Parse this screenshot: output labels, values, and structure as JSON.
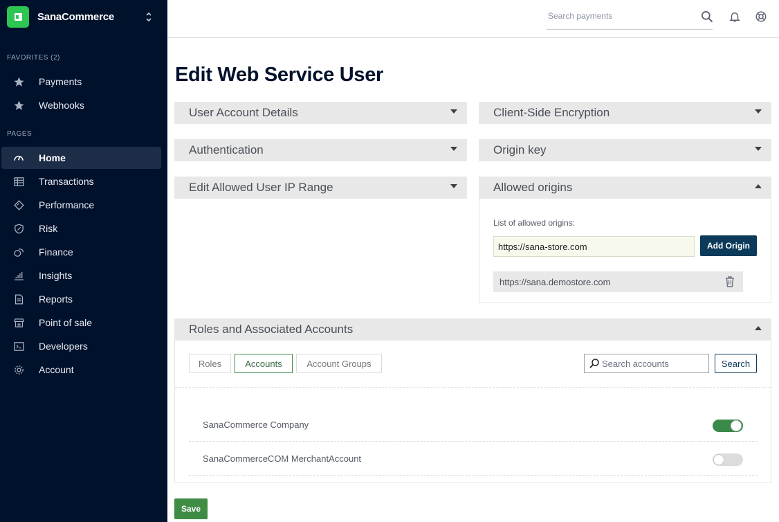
{
  "app": {
    "name": "SanaCommerce"
  },
  "sidebar": {
    "favorites_label": "FAVORITES (2)",
    "favorites": [
      {
        "label": "Payments",
        "icon": "star-icon"
      },
      {
        "label": "Webhooks",
        "icon": "star-icon"
      }
    ],
    "pages_label": "PAGES",
    "pages": [
      {
        "label": "Home",
        "icon": "gauge-icon",
        "active": true
      },
      {
        "label": "Transactions",
        "icon": "table-icon"
      },
      {
        "label": "Performance",
        "icon": "diamond-icon"
      },
      {
        "label": "Risk",
        "icon": "shield-icon"
      },
      {
        "label": "Finance",
        "icon": "coins-icon"
      },
      {
        "label": "Insights",
        "icon": "bar-chart-icon"
      },
      {
        "label": "Reports",
        "icon": "document-icon"
      },
      {
        "label": "Point of sale",
        "icon": "store-icon"
      },
      {
        "label": "Developers",
        "icon": "terminal-icon"
      },
      {
        "label": "Account",
        "icon": "gear-icon"
      }
    ]
  },
  "topbar": {
    "search_placeholder": "Search payments"
  },
  "page": {
    "title": "Edit Web Service User"
  },
  "panels": {
    "user_account_details": "User Account Details",
    "client_side_encryption": "Client-Side Encryption",
    "authentication": "Authentication",
    "origin_key": "Origin key",
    "edit_allowed_ip": "Edit Allowed User IP Range",
    "allowed_origins": "Allowed origins",
    "roles_accounts": "Roles and Associated Accounts"
  },
  "allowed_origins": {
    "list_label": "List of allowed origins:",
    "input_value": "https://sana-store.com",
    "add_button": "Add Origin",
    "origins": [
      "https://sana.demostore.com"
    ]
  },
  "roles": {
    "tabs": [
      "Roles",
      "Accounts",
      "Account Groups"
    ],
    "active_tab": "Accounts",
    "search_placeholder": "Search accounts",
    "search_button": "Search",
    "accounts": [
      {
        "name": "SanaCommerce Company",
        "enabled": true
      },
      {
        "name": "SanaCommerceCOM MerchantAccount",
        "enabled": false
      }
    ]
  },
  "actions": {
    "save": "Save"
  },
  "colors": {
    "sidebar_bg": "#00112c",
    "brand_green": "#2dc653",
    "primary_navy": "#0b3a5a",
    "save_green": "#3f8c45",
    "toggle_on": "#3a8a4a"
  }
}
